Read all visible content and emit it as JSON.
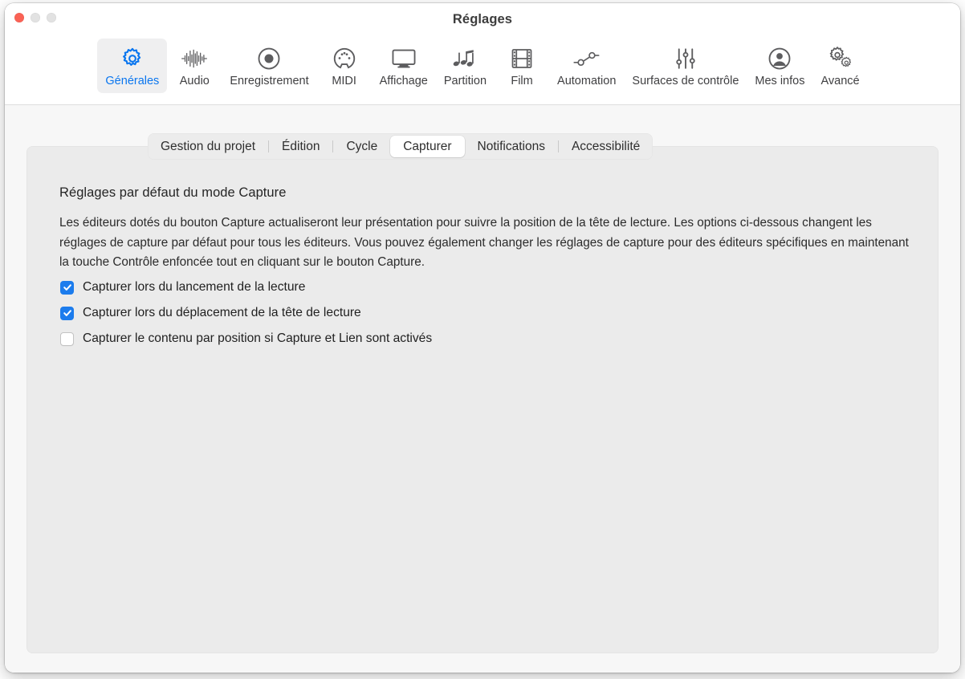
{
  "window": {
    "title": "Réglages",
    "traffic_lights": [
      {
        "name": "close",
        "color": "#fa6255"
      },
      {
        "name": "minimize",
        "color": "#e2e2e2"
      },
      {
        "name": "zoom",
        "color": "#e2e2e2"
      }
    ]
  },
  "toolbar": {
    "selected": "Générales",
    "accent_color": "#0a76ef",
    "items": [
      {
        "label": "Générales",
        "icon": "gear-icon",
        "selected": true
      },
      {
        "label": "Audio",
        "icon": "waveform-icon",
        "selected": false
      },
      {
        "label": "Enregistrement",
        "icon": "record-circle-icon",
        "selected": false
      },
      {
        "label": "MIDI",
        "icon": "midi-port-icon",
        "selected": false
      },
      {
        "label": "Affichage",
        "icon": "display-monitor-icon",
        "selected": false
      },
      {
        "label": "Partition",
        "icon": "music-notes-icon",
        "selected": false
      },
      {
        "label": "Film",
        "icon": "film-strip-icon",
        "selected": false
      },
      {
        "label": "Automation",
        "icon": "automation-nodes-icon",
        "selected": false
      },
      {
        "label": "Surfaces de contrôle",
        "icon": "sliders-icon",
        "selected": false
      },
      {
        "label": "Mes infos",
        "icon": "person-circle-icon",
        "selected": false
      },
      {
        "label": "Avancé",
        "icon": "double-gear-icon",
        "selected": false
      }
    ]
  },
  "tabs": {
    "selected": "Capturer",
    "items": [
      {
        "label": "Gestion du projet",
        "selected": false,
        "separator_after": true
      },
      {
        "label": "Édition",
        "selected": false,
        "separator_after": true
      },
      {
        "label": "Cycle",
        "selected": false,
        "separator_after": false
      },
      {
        "label": "Capturer",
        "selected": true,
        "separator_after": false
      },
      {
        "label": "Notifications",
        "selected": false,
        "separator_after": true
      },
      {
        "label": "Accessibilité",
        "selected": false,
        "separator_after": false
      }
    ]
  },
  "content": {
    "section_title": "Réglages par défaut du mode Capture",
    "description": "Les éditeurs dotés du bouton Capture actualiseront leur présentation pour suivre la position de la tête de lecture. Les options ci-dessous changent les réglages de capture par défaut pour tous les éditeurs. Vous pouvez également changer les réglages de capture pour des éditeurs spécifiques en maintenant la touche Contrôle enfoncée tout en cliquant sur le bouton Capture.",
    "checkboxes": [
      {
        "label": "Capturer lors du lancement de la lecture",
        "checked": true
      },
      {
        "label": "Capturer lors du déplacement de la tête de lecture",
        "checked": true
      },
      {
        "label": "Capturer le contenu par position si Capture et Lien sont activés",
        "checked": false
      }
    ],
    "checkbox_on_color": "#1c7ced"
  }
}
